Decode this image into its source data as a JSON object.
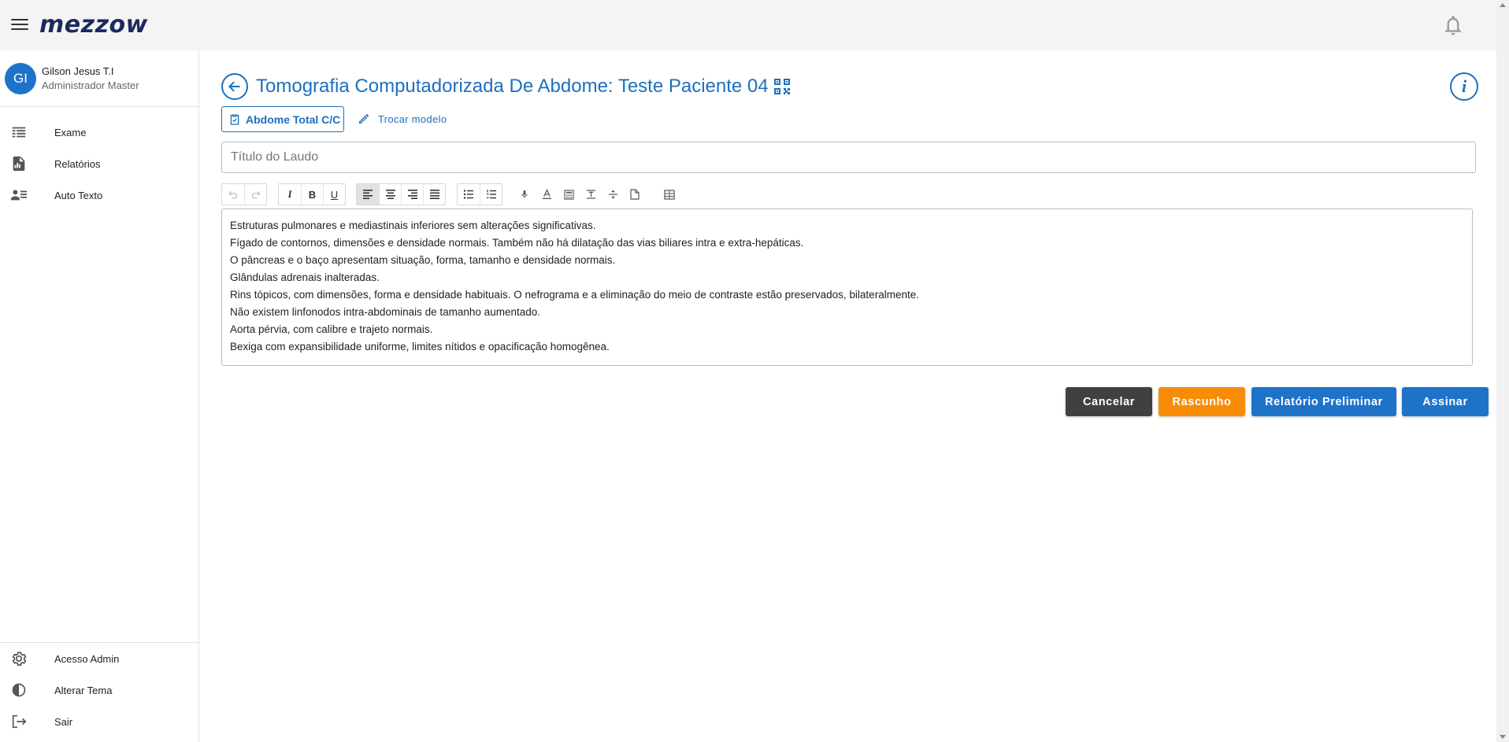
{
  "app": {
    "logo": "mezzow"
  },
  "user": {
    "initials": "GI",
    "name": "Gilson Jesus T.I",
    "role": "Administrador Master"
  },
  "sidebar": {
    "items": [
      {
        "label": "Exame",
        "icon": "list-icon"
      },
      {
        "label": "Relatórios",
        "icon": "report-icon"
      },
      {
        "label": "Auto Texto",
        "icon": "contacts-icon"
      }
    ],
    "bottom_items": [
      {
        "label": "Acesso Admin",
        "icon": "gear-icon"
      },
      {
        "label": "Alterar Tema",
        "icon": "contrast-icon"
      },
      {
        "label": "Sair",
        "icon": "logout-icon"
      }
    ]
  },
  "page": {
    "title": "Tomografia Computadorizada De Abdome: Teste Paciente 04",
    "model_label": "Abdome Total C/C",
    "swap_label": "Trocar modelo",
    "title_placeholder": "Título do Laudo"
  },
  "toolbar": {
    "buttons": [
      "undo-icon",
      "redo-icon",
      "italic",
      "bold",
      "underline",
      "align-left",
      "align-center",
      "align-right",
      "align-justify",
      "bullet-list",
      "numbered-list",
      "mic",
      "font-color",
      "calculator",
      "line-height",
      "strikethrough",
      "document",
      "table"
    ],
    "bold": "B",
    "italic": "I",
    "underline": "U"
  },
  "editor": {
    "lines": [
      "Estruturas pulmonares e mediastinais inferiores sem alterações significativas.",
      "Fígado de contornos, dimensões e densidade normais. Também não há dilatação das vias biliares intra e extra-hepáticas.",
      "O pâncreas e o baço apresentam situação, forma, tamanho e densidade normais.",
      "Glândulas adrenais inalteradas.",
      "Rins tópicos, com dimensões, forma e densidade habituais. O nefrograma e a eliminação do meio de contraste estão preservados, bilateralmente.",
      "Não existem linfonodos intra-abdominais de tamanho aumentado.",
      "Aorta pérvia, com calibre e trajeto normais.",
      "Bexiga com expansibilidade uniforme, limites nítidos e opacificação homogênea."
    ]
  },
  "actions": {
    "cancel": "Cancelar",
    "draft": "Rascunho",
    "preliminary": "Relatório Preliminar",
    "sign": "Assinar"
  },
  "colors": {
    "primary": "#1e73c9",
    "draft": "#f98c07",
    "cancel": "#404040",
    "logo": "#1c2a5e"
  }
}
